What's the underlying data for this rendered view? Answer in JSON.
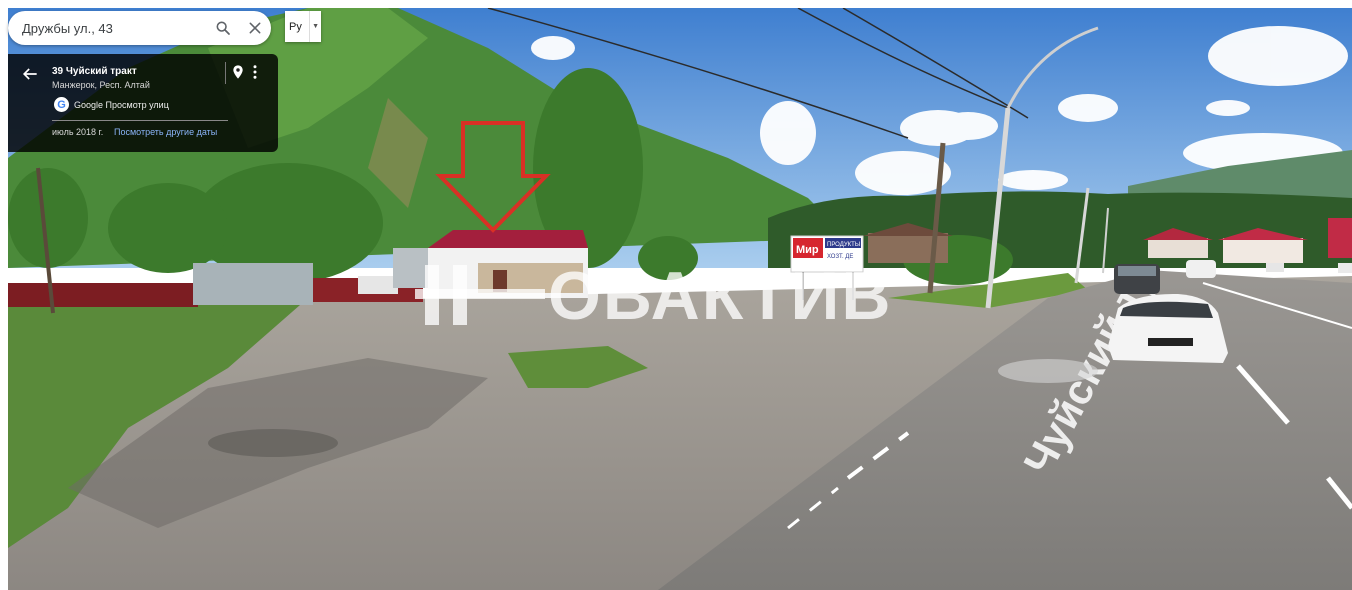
{
  "search": {
    "value": "Дружбы ул., 43",
    "placeholder": ""
  },
  "language": {
    "label": "Ру"
  },
  "place_card": {
    "title": "39 Чуйский тракт",
    "subtitle": "Манжерок, Респ. Алтай",
    "provider": "Google Просмотр улиц",
    "date": "июль 2018 г.",
    "other_dates_link": "Посмотреть другие даты"
  },
  "scene": {
    "watermark_text": "ОВАКТИВ",
    "street_marking": "Чуйский тр",
    "billboard_top": "Мир",
    "billboard_label": "ПРОДУКТЫ",
    "billboard_sub": "ХОЗТ. ДЕ"
  },
  "icons": {
    "search": "search-icon",
    "close": "close-icon",
    "back": "back-arrow-icon",
    "pin": "location-pin-icon",
    "more": "more-vert-icon"
  },
  "colors": {
    "accent_link": "#8ab4f8",
    "arrow": "#d93025"
  }
}
